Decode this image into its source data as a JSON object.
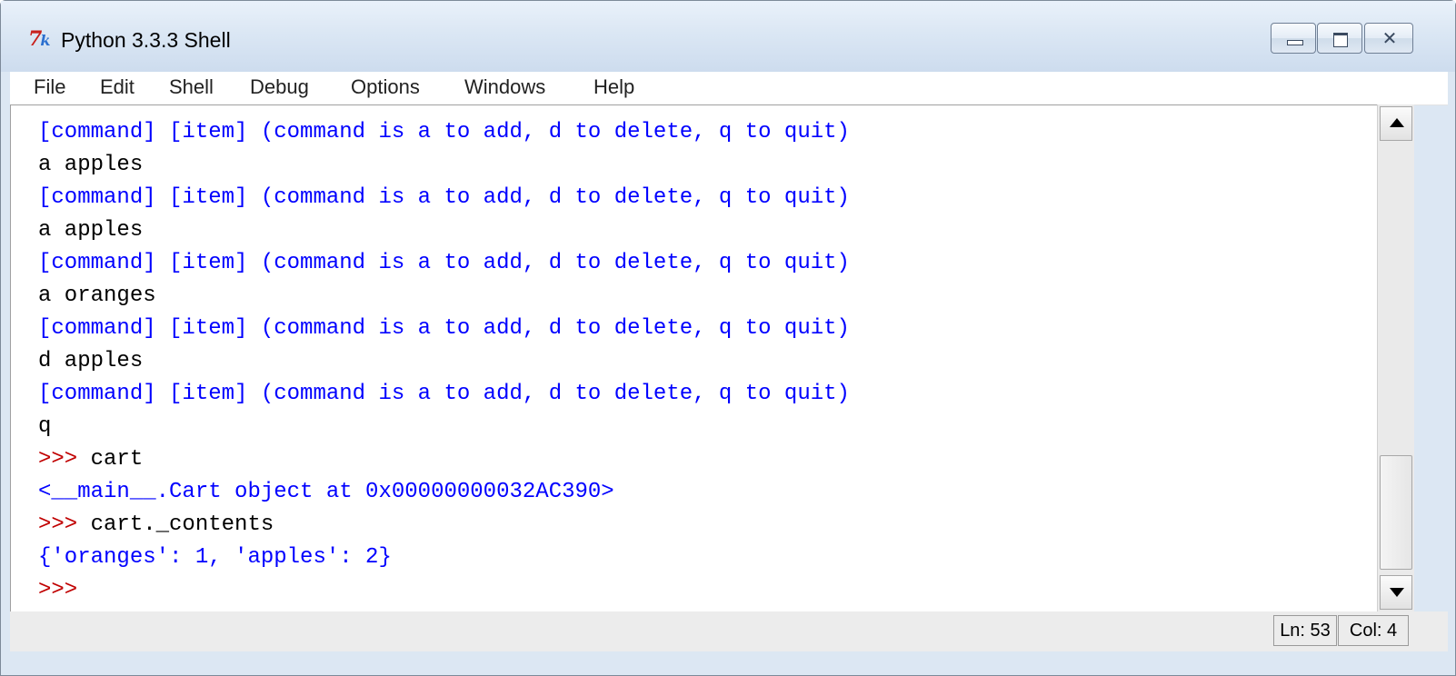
{
  "window": {
    "title": "Python 3.3.3 Shell",
    "icon": "tk-icon",
    "controls": {
      "minimize": "minimize",
      "maximize": "maximize",
      "close": "✕"
    }
  },
  "menu": [
    "File",
    "Edit",
    "Shell",
    "Debug",
    "Options",
    "Windows",
    "Help"
  ],
  "shell": {
    "lines": [
      {
        "text": "[command] [item] (command is a to add, d to delete, q to quit)",
        "kind": "output"
      },
      {
        "text": "a apples",
        "kind": "input"
      },
      {
        "text": "[command] [item] (command is a to add, d to delete, q to quit)",
        "kind": "output"
      },
      {
        "text": "a apples",
        "kind": "input"
      },
      {
        "text": "[command] [item] (command is a to add, d to delete, q to quit)",
        "kind": "output"
      },
      {
        "text": "a oranges",
        "kind": "input"
      },
      {
        "text": "[command] [item] (command is a to add, d to delete, q to quit)",
        "kind": "output"
      },
      {
        "text": "d apples",
        "kind": "input"
      },
      {
        "text": "[command] [item] (command is a to add, d to delete, q to quit)",
        "kind": "output"
      },
      {
        "text": "q",
        "kind": "input"
      },
      {
        "prompt": ">>> ",
        "text": "cart",
        "kind": "command"
      },
      {
        "text": "<__main__.Cart object at 0x00000000032AC390>",
        "kind": "output"
      },
      {
        "prompt": ">>> ",
        "text": "cart._contents",
        "kind": "command"
      },
      {
        "text": "{'oranges': 1, 'apples': 2}",
        "kind": "output"
      },
      {
        "prompt": ">>> ",
        "text": "",
        "kind": "command"
      }
    ]
  },
  "status": {
    "line": "Ln: 53",
    "col": "Col: 4"
  },
  "colors": {
    "output": "#0000ff",
    "input": "#000000",
    "prompt": "#c00000"
  }
}
